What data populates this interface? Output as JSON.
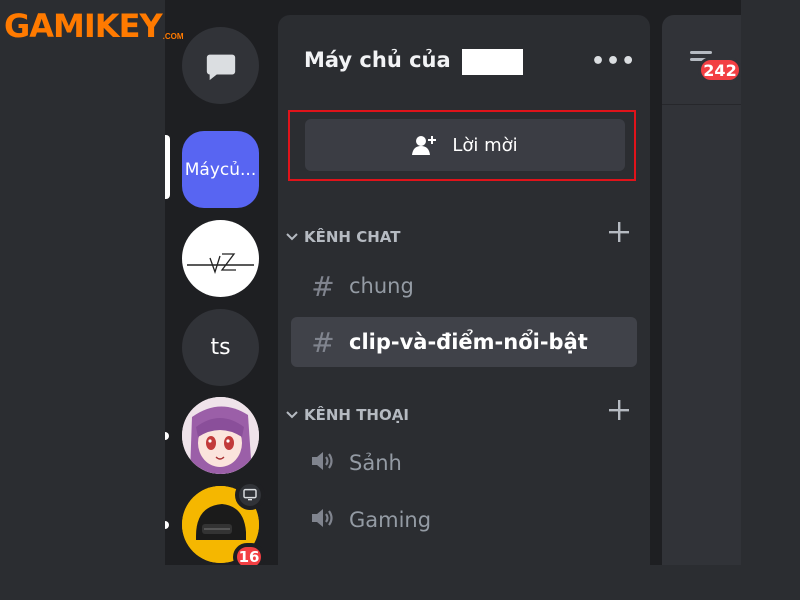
{
  "logo": {
    "main": "GAMIKEY",
    "suffix": ".COM"
  },
  "panel": {
    "server_name": "Máy chủ của",
    "more_label": "•••",
    "invite_label": "Lời mời"
  },
  "servers": [
    {
      "name": "dm",
      "icon": "chat-bubble-icon"
    },
    {
      "name": "active",
      "label": "Máycủ..."
    },
    {
      "name": "vz",
      "label": "VZ"
    },
    {
      "name": "ts",
      "label": "ts"
    },
    {
      "name": "anime",
      "icon": "anime-avatar"
    },
    {
      "name": "pubg",
      "icon": "helmet-avatar",
      "badge": "16"
    }
  ],
  "categories": {
    "chat": "KÊNH CHAT",
    "voice": "KÊNH THOẠI"
  },
  "channels": {
    "text": [
      {
        "name": "chung",
        "icon": "#",
        "active": false
      },
      {
        "name": "clip-và-điểm-nổi-bật",
        "icon": "#",
        "active": true
      }
    ],
    "voice": [
      {
        "name": "Sảnh",
        "icon": "speaker-icon"
      },
      {
        "name": "Gaming",
        "icon": "speaker-icon"
      }
    ]
  },
  "right_panel": {
    "badge": "242"
  },
  "colors": {
    "accent": "#5865f2",
    "badge_red": "#f23f43",
    "highlight_border": "#e0131a",
    "logo_orange": "#ff7a00"
  }
}
